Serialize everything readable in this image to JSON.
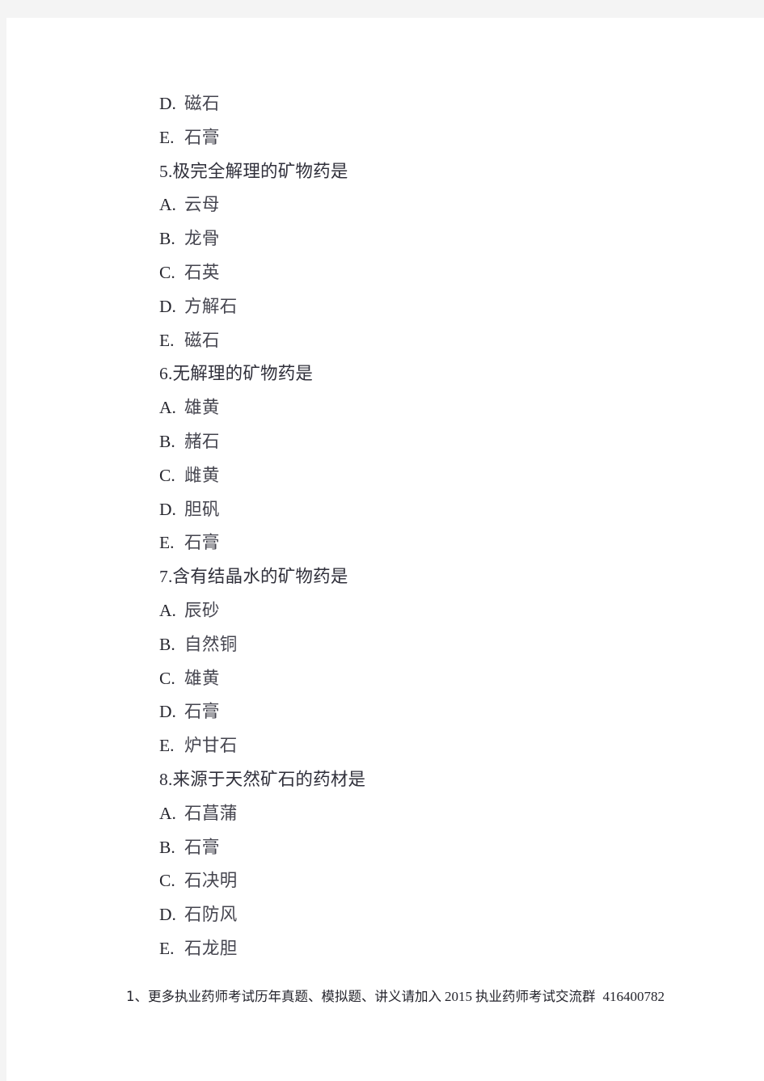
{
  "page": {
    "background_color": "#ffffff",
    "surround_color": "#f4f4f4"
  },
  "document": {
    "lines": [
      {
        "type": "option",
        "letter": "D.",
        "text": "磁石"
      },
      {
        "type": "option",
        "letter": "E.",
        "text": "石膏"
      },
      {
        "type": "question",
        "number": "5.",
        "text": "极完全解理的矿物药是"
      },
      {
        "type": "option",
        "letter": "A.",
        "text": "云母"
      },
      {
        "type": "option",
        "letter": "B.",
        "text": "龙骨"
      },
      {
        "type": "option",
        "letter": "C.",
        "text": "石英"
      },
      {
        "type": "option",
        "letter": "D.",
        "text": "方解石"
      },
      {
        "type": "option",
        "letter": "E.",
        "text": "磁石"
      },
      {
        "type": "question",
        "number": "6.",
        "text": "无解理的矿物药是"
      },
      {
        "type": "option",
        "letter": "A.",
        "text": "雄黄"
      },
      {
        "type": "option",
        "letter": "B.",
        "text": "赭石"
      },
      {
        "type": "option",
        "letter": "C.",
        "text": "雌黄"
      },
      {
        "type": "option",
        "letter": "D.",
        "text": "胆矾"
      },
      {
        "type": "option",
        "letter": "E.",
        "text": "石膏"
      },
      {
        "type": "question",
        "number": "7.",
        "text": "含有结晶水的矿物药是"
      },
      {
        "type": "option",
        "letter": "A.",
        "text": "辰砂"
      },
      {
        "type": "option",
        "letter": "B.",
        "text": "自然铜"
      },
      {
        "type": "option",
        "letter": "C.",
        "text": "雄黄"
      },
      {
        "type": "option",
        "letter": "D.",
        "text": "石膏"
      },
      {
        "type": "option",
        "letter": "E.",
        "text": "炉甘石"
      },
      {
        "type": "question",
        "number": "8.",
        "text": "来源于天然矿石的药材是"
      },
      {
        "type": "option",
        "letter": "A.",
        "text": "石菖蒲"
      },
      {
        "type": "option",
        "letter": "B.",
        "text": "石膏"
      },
      {
        "type": "option",
        "letter": "C.",
        "text": "石决明"
      },
      {
        "type": "option",
        "letter": "D.",
        "text": "石防风"
      },
      {
        "type": "option",
        "letter": "E.",
        "text": "石龙胆"
      }
    ]
  },
  "footer": {
    "part1": "1、更多执业药师考试历年真题、模拟题、讲义请加入",
    "year": "2015",
    "part2": "执业药师考试交流群",
    "group_number": "416400782"
  }
}
